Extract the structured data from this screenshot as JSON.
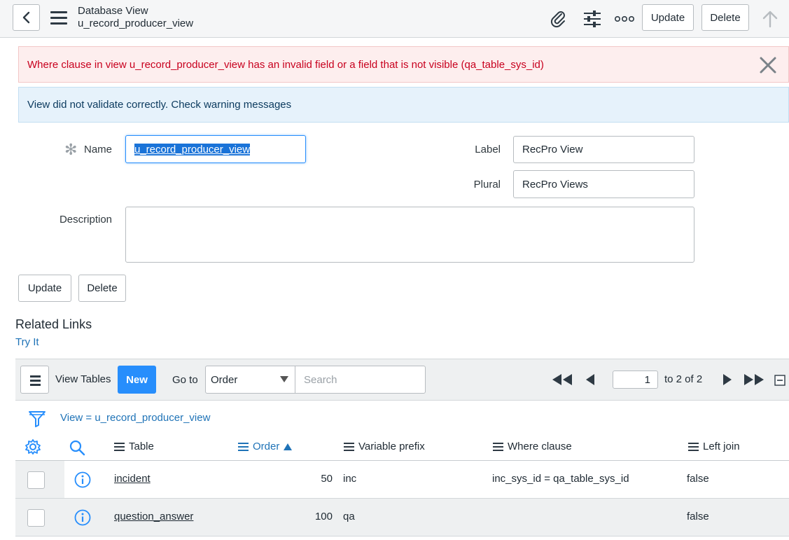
{
  "header": {
    "title": "Database View",
    "subtitle": "u_record_producer_view",
    "update_label": "Update",
    "delete_label": "Delete"
  },
  "alerts": {
    "error": "Where clause in view u_record_producer_view has an invalid field or a field that is not visible (qa_table_sys_id)",
    "info": "View did not validate correctly. Check warning messages"
  },
  "form": {
    "name_label": "Name",
    "name_value": "u_record_producer_view",
    "label_label": "Label",
    "label_value": "RecPro View",
    "plural_label": "Plural",
    "plural_value": "RecPro Views",
    "description_label": "Description",
    "description_value": "",
    "update_label": "Update",
    "delete_label": "Delete"
  },
  "related": {
    "title": "Related Links",
    "try_it": "Try It"
  },
  "list": {
    "title": "View Tables",
    "new_label": "New",
    "goto_label": "Go to",
    "goto_selected": "Order",
    "search_placeholder": "Search",
    "page_number": "1",
    "page_range": "to 2 of 2",
    "filter": "View = u_record_producer_view",
    "columns": [
      "Table",
      "Order",
      "Variable prefix",
      "Where clause",
      "Left join"
    ],
    "rows": [
      {
        "table": "incident",
        "order": "50",
        "prefix": "inc",
        "where": "inc_sys_id = qa_table_sys_id",
        "left_join": "false"
      },
      {
        "table": "question_answer",
        "order": "100",
        "prefix": "qa",
        "where": "",
        "left_join": "false"
      }
    ]
  },
  "colors": {
    "accent": "#278efc",
    "link": "#1f73b7",
    "error_text": "#c8001e",
    "error_bg": "#fdeeee",
    "info_bg": "#e6f2fb"
  }
}
